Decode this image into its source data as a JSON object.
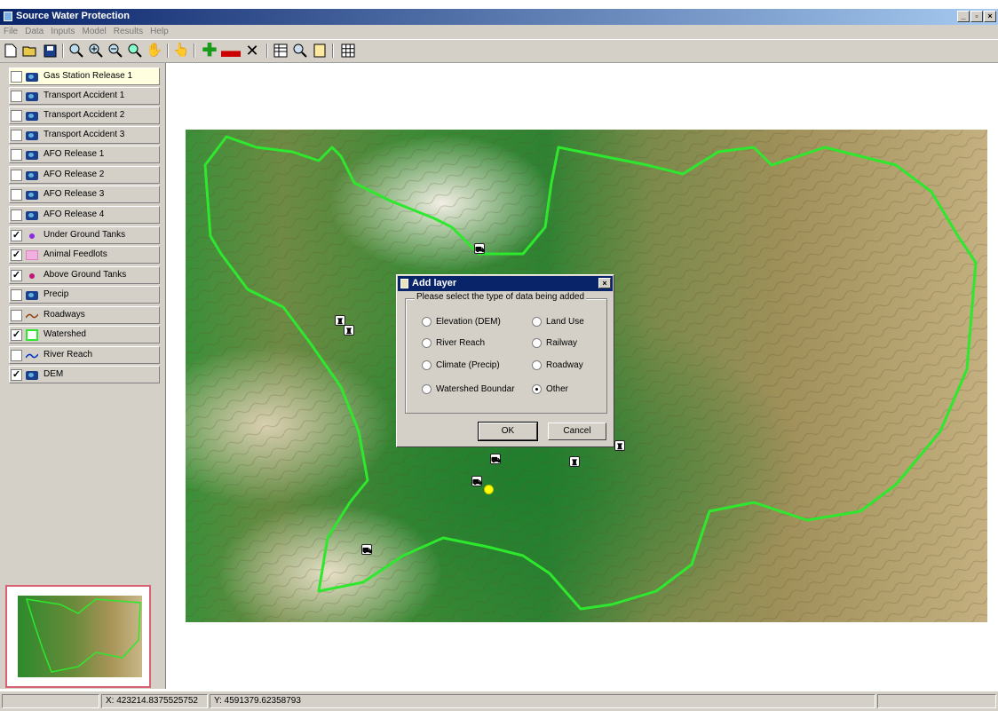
{
  "window": {
    "title": "Source Water Protection",
    "buttons": [
      "_",
      "▫",
      "×"
    ]
  },
  "menu": [
    "File",
    "Data",
    "Inputs",
    "Model",
    "Results",
    "Help"
  ],
  "toolbar": {
    "icons": [
      "new-icon",
      "open-icon",
      "save-icon",
      "zoom-icon",
      "zoom-in-icon",
      "zoom-out-icon",
      "zoom-full-icon",
      "pan-icon",
      "select-icon",
      "add-layer-icon",
      "remove-layer-icon",
      "delete-icon",
      "table-icon",
      "find-icon",
      "layout-icon",
      "grid-icon"
    ]
  },
  "layers": [
    {
      "name": "Gas Station Release 1",
      "checked": false,
      "symbol": "map",
      "selected": true
    },
    {
      "name": "Transport Accident 1",
      "checked": false,
      "symbol": "map"
    },
    {
      "name": "Transport Accident 2",
      "checked": false,
      "symbol": "map"
    },
    {
      "name": "Transport Accident 3",
      "checked": false,
      "symbol": "map"
    },
    {
      "name": "AFO Release 1",
      "checked": false,
      "symbol": "map"
    },
    {
      "name": "AFO Release 2",
      "checked": false,
      "symbol": "map"
    },
    {
      "name": "AFO Release 3",
      "checked": false,
      "symbol": "map"
    },
    {
      "name": "AFO Release 4",
      "checked": false,
      "symbol": "map"
    },
    {
      "name": "Under Ground Tanks",
      "checked": true,
      "symbol": "dot-purple"
    },
    {
      "name": "Animal Feedlots",
      "checked": true,
      "symbol": "pink-box"
    },
    {
      "name": "Above Ground Tanks",
      "checked": true,
      "symbol": "dot-magenta"
    },
    {
      "name": "Precip",
      "checked": false,
      "symbol": "map"
    },
    {
      "name": "Roadways",
      "checked": false,
      "symbol": "line-brown"
    },
    {
      "name": "Watershed",
      "checked": true,
      "symbol": "green-box"
    },
    {
      "name": "River Reach",
      "checked": false,
      "symbol": "line-blue"
    },
    {
      "name": "DEM",
      "checked": true,
      "symbol": "map"
    }
  ],
  "dialog": {
    "title": "Add layer",
    "close": "×",
    "prompt": "Please select the type of data being added",
    "options_left": [
      "Elevation (DEM)",
      "River Reach",
      "Climate (Precip)",
      "Watershed Boundar"
    ],
    "options_right": [
      "Land Use",
      "Railway",
      "Roadway",
      "Other"
    ],
    "selected": "Other",
    "ok": "OK",
    "cancel": "Cancel"
  },
  "status": {
    "x": "X: 423214.8375525752",
    "y": "Y: 4591379.62358793"
  },
  "colors": {
    "watershed": "#2ee82e",
    "titlebar": "#0a246a",
    "panel": "#d4d0c8"
  }
}
